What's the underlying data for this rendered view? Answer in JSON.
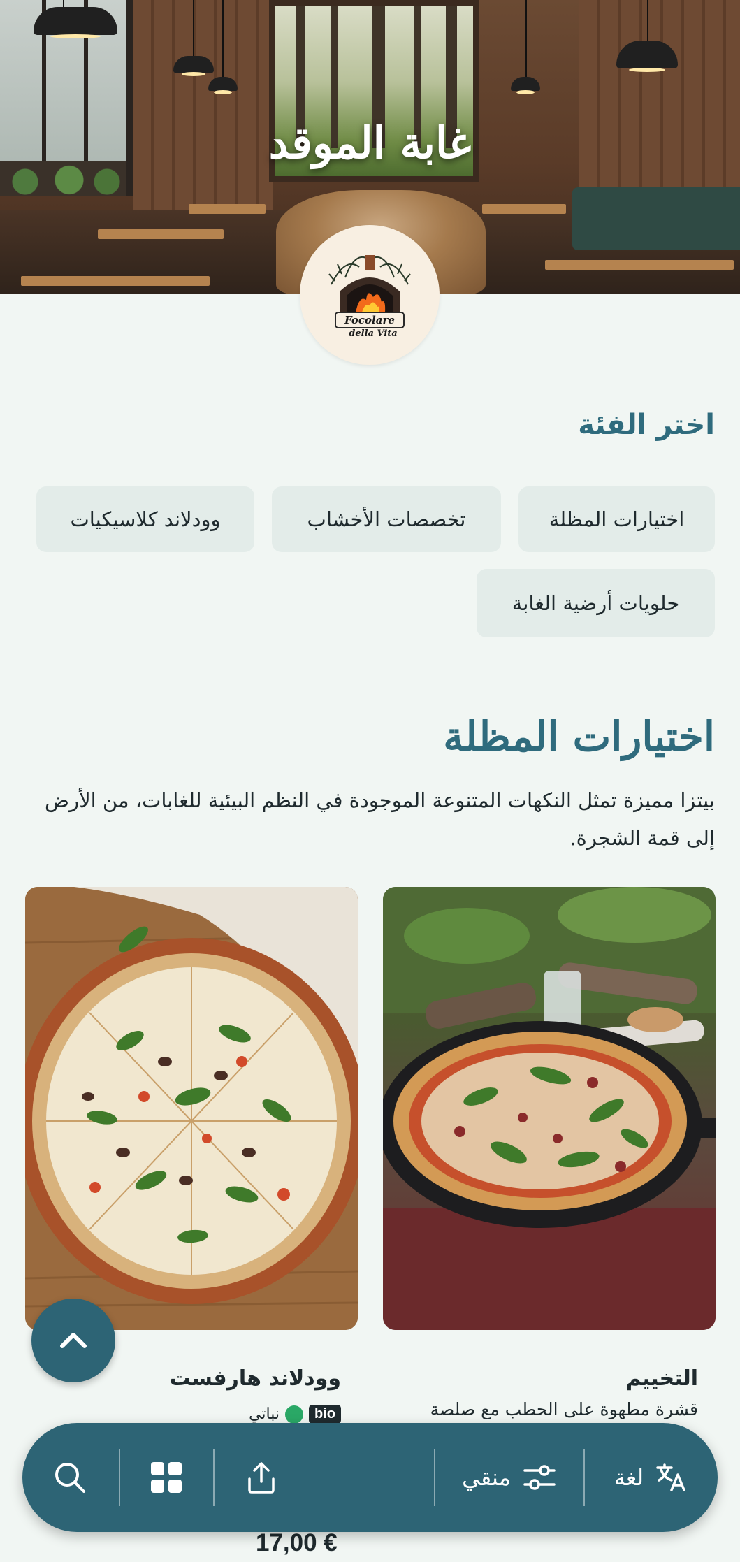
{
  "hero": {
    "title": "غابة الموقد"
  },
  "logo": {
    "line1": "Focolare",
    "line2": "della Vita"
  },
  "categories": {
    "heading": "اختر الفئة",
    "chips": [
      "اختيارات المظلة",
      "تخصصات الأخشاب",
      "وودلاند كلاسيكيات",
      "حلويات أرضية الغابة"
    ]
  },
  "section": {
    "title": "اختيارات المظلة",
    "description": "بيتزا مميزة تمثل النكهات المتنوعة الموجودة في النظم البيئية للغابات، من الأرض إلى قمة الشجرة."
  },
  "items": [
    {
      "name": "التخييم",
      "description": "قشرة مطهوة على الحطب مع صلصة"
    },
    {
      "name": "وودلاند هارفست",
      "badge": "bio",
      "tag": "نباتي",
      "price": "17,00 €"
    }
  ],
  "nav": {
    "language_label": "لغة",
    "filter_label": "منقي"
  },
  "colors": {
    "accent": "#2d6475",
    "heading": "#2f6b7d",
    "chip_bg": "#e3ece9",
    "page_bg": "#f1f6f3"
  }
}
